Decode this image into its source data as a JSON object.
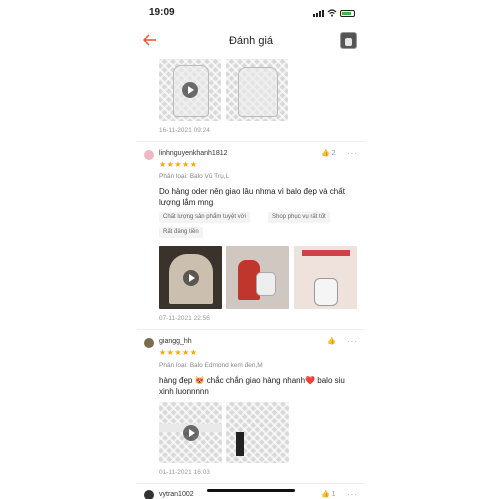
{
  "status_bar": {
    "time": "19:09"
  },
  "header": {
    "title": "Đánh giá",
    "back_icon": "arrow-left-icon"
  },
  "reviews": [
    {
      "date": "16-11-2021 09:24"
    },
    {
      "username": "linhnguyenkhanh1812",
      "stars": "★★★★★",
      "variant": "Phân loại: Balo Vũ Trụ,L",
      "text": "Do hàng oder nên giao lâu nhma vì balo đẹp và chất lượng lắm mng",
      "tags": [
        "Chất lượng sản phẩm tuyệt vời",
        "Shop phục vụ rất tốt",
        "Rất đáng tiền"
      ],
      "likes": "2",
      "date": "07-11-2021 22:56"
    },
    {
      "username": "giangg_hh",
      "stars": "★★★★★",
      "variant": "Phân loại: Balo Edmond kem đen,M",
      "text": "hàng đẹp 😻 chắc chắn giao hàng nhanh❤️ balo siu xinh luonnnnn",
      "date": "01-11-2021 16:03"
    },
    {
      "username": "vytran1002",
      "likes": "1"
    }
  ],
  "more_label": "···"
}
